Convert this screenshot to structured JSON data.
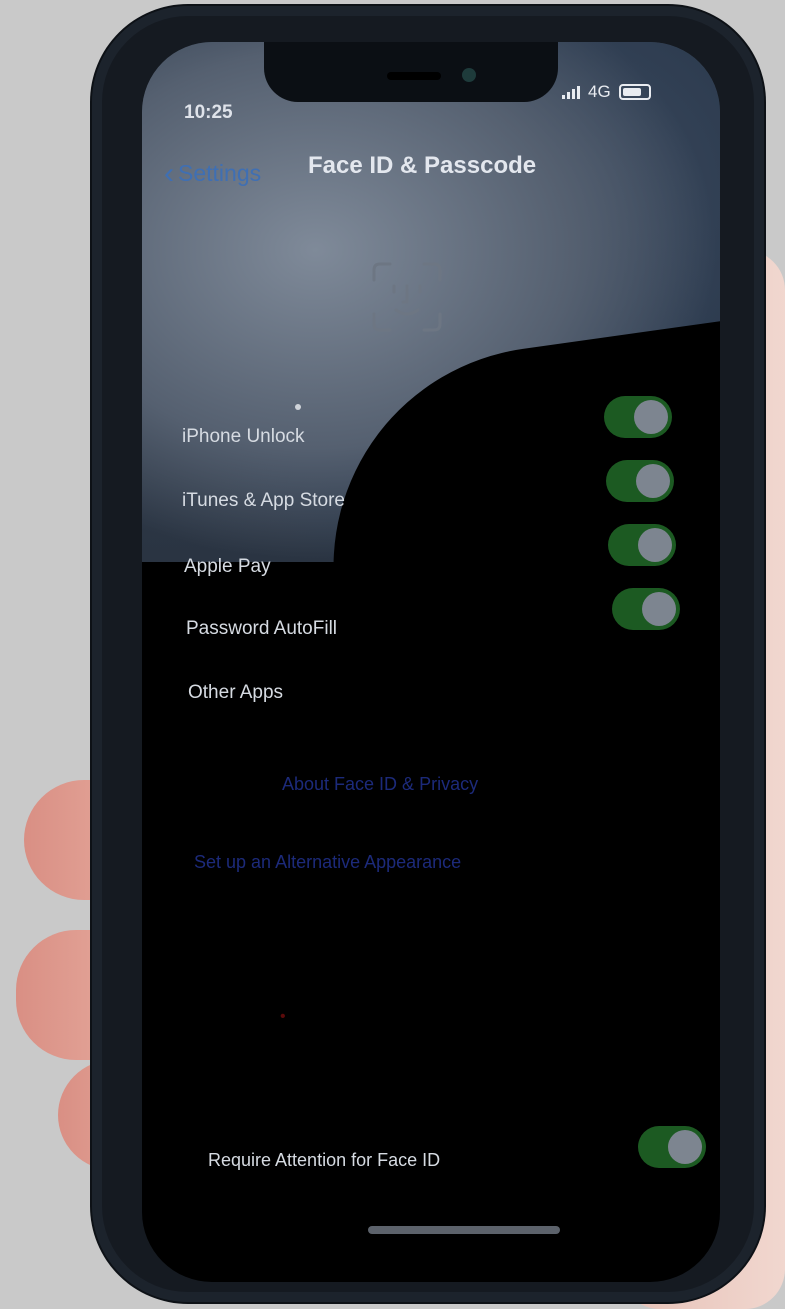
{
  "status": {
    "time": "10:25",
    "network": "4G"
  },
  "nav": {
    "back_label": "Settings",
    "title": "Face ID & Passcode"
  },
  "section": {
    "rows": [
      {
        "label": "iPhone Unlock",
        "on": true
      },
      {
        "label": "iTunes & App Store",
        "on": true
      },
      {
        "label": "Apple Pay",
        "on": true
      },
      {
        "label": "Password AutoFill",
        "on": true
      },
      {
        "label": "Other Apps"
      }
    ]
  },
  "links": {
    "about": "About Face ID & Privacy",
    "alt_appearance": "Set up an Alternative Appearance"
  },
  "attention": {
    "label": "Require Attention for Face ID",
    "on": true
  },
  "colors": {
    "toggle_on": "#1c5a22",
    "link": "#1c2a7a",
    "back": "#3f6fb3"
  }
}
